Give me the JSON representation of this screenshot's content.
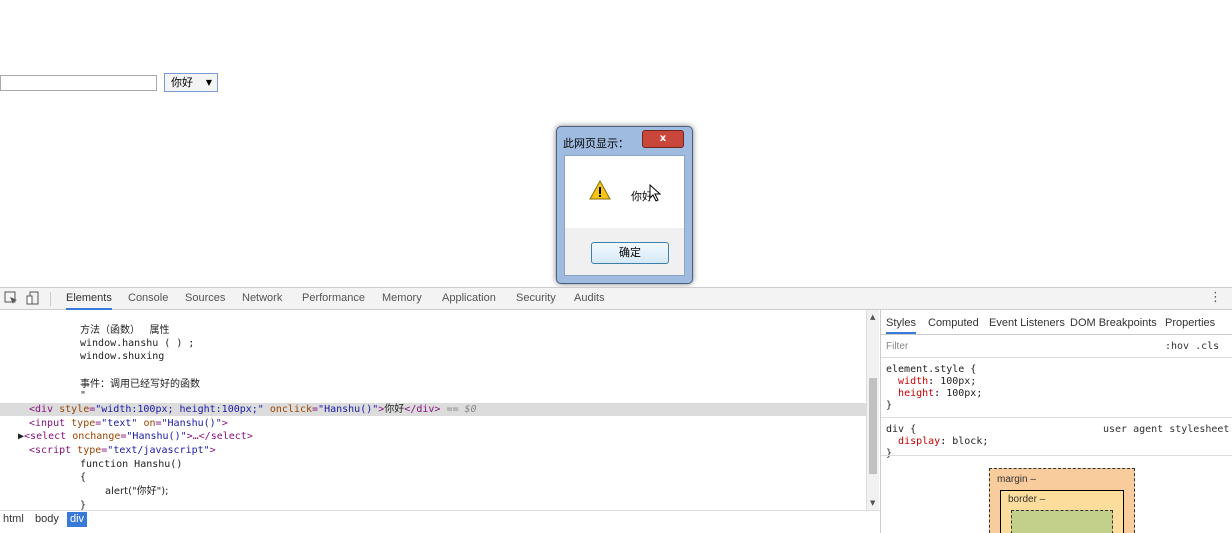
{
  "page": {
    "text_input": {
      "value": "",
      "placeholder": ""
    },
    "select": {
      "selected": "你好"
    }
  },
  "alert": {
    "title": "此网页显示：",
    "close_label": "x",
    "message": "你好",
    "ok_label": "确定"
  },
  "devtools": {
    "tabs": [
      "Elements",
      "Console",
      "Sources",
      "Network",
      "Performance",
      "Memory",
      "Application",
      "Security",
      "Audits"
    ],
    "active_tab": "Elements",
    "menu_icon": "vertical-dots-icon",
    "code_lines": {
      "l1": "方法（函数）   属性",
      "l2": "window.hanshu ( ) ;",
      "l3": "window.shuxing",
      "l4": "事件：调用已经写好的函数",
      "l5": "\"",
      "div_tag_open": "<div ",
      "div_attr1": "style",
      "div_attr1_val": "\"width:100px; height:100px;\"",
      "div_attr2": "onclick",
      "div_attr2_val": "\"Hanshu()\"",
      "div_text": "你好",
      "div_close": "</div>",
      "div_eq": " == $0",
      "input_line_tag": "<input ",
      "input_attr1": "type",
      "input_attr1_val": "\"text\"",
      "input_attr2": "on",
      "input_attr2_val": "\"Hanshu()\"",
      "select_open": "<select ",
      "select_attr": "onchange",
      "select_attr_val": "\"Hanshu()\"",
      "select_close": ">…</select>",
      "script_open": "<script ",
      "script_attr": "type",
      "script_attr_val": "\"text/javascript\"",
      "fn_line": "function Hanshu()",
      "brace_open": "{",
      "alert_line": "alert(\"你好\");",
      "brace_close": "}"
    },
    "breadcrumb": [
      "html",
      "body",
      "div"
    ],
    "styles": {
      "tabs": [
        "Styles",
        "Computed",
        "Event Listeners",
        "DOM Breakpoints",
        "Properties"
      ],
      "filter_placeholder": "Filter",
      "hov_cls": ":hov  .cls",
      "rule1_selector": "element.style {",
      "rule1_p1_name": "width",
      "rule1_p1_val": "100px;",
      "rule1_p2_name": "height",
      "rule1_p2_val": "100px;",
      "rule_close": "}",
      "rule2_selector": "div {",
      "rule2_source": "user agent stylesheet",
      "rule2_p1_name": "display",
      "rule2_p1_val": "block;",
      "box_margin_label": "margin   –",
      "box_border_label": "border   –"
    }
  }
}
